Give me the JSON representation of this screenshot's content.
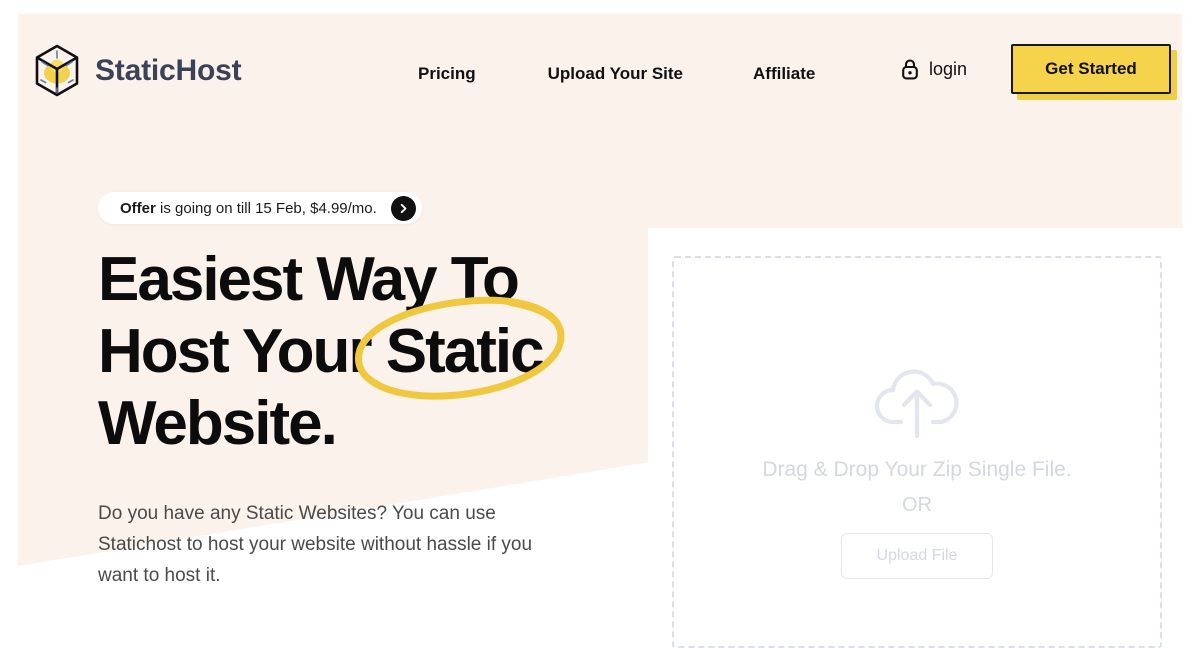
{
  "colors": {
    "hero_bg": "#FCF2EC",
    "accent_yellow": "#F5D34B",
    "logo_navy": "#3B4257",
    "ink": "#0C0C0C",
    "muted_gray": "#D4D7E2"
  },
  "header": {
    "logo": {
      "mark_icon": "cube-logo-icon",
      "text": "StaticHost"
    },
    "nav": [
      {
        "label": "Pricing"
      },
      {
        "label": "Upload Your Site"
      },
      {
        "label": "Affiliate"
      }
    ],
    "login": {
      "icon": "lock-icon",
      "label": "login"
    },
    "cta": {
      "label": "Get Started"
    }
  },
  "hero": {
    "offer": {
      "strong": "Offer",
      "rest": " is going on till 15 Feb, $4.99/mo.",
      "arrow_icon": "chevron-right-icon"
    },
    "headline_lines": [
      "Easiest Way To",
      "Host Your Static",
      "Website."
    ],
    "highlighted_word": "Static",
    "annotation_icon": "hand-drawn-ellipse",
    "subtitle": "Do you have any Static Websites? You can use Statichost to host your website without hassle if you want to host it."
  },
  "upload": {
    "icon": "cloud-upload-icon",
    "drop_text": "Drag & Drop Your Zip Single File.",
    "or_text": "OR",
    "button_label": "Upload File"
  }
}
